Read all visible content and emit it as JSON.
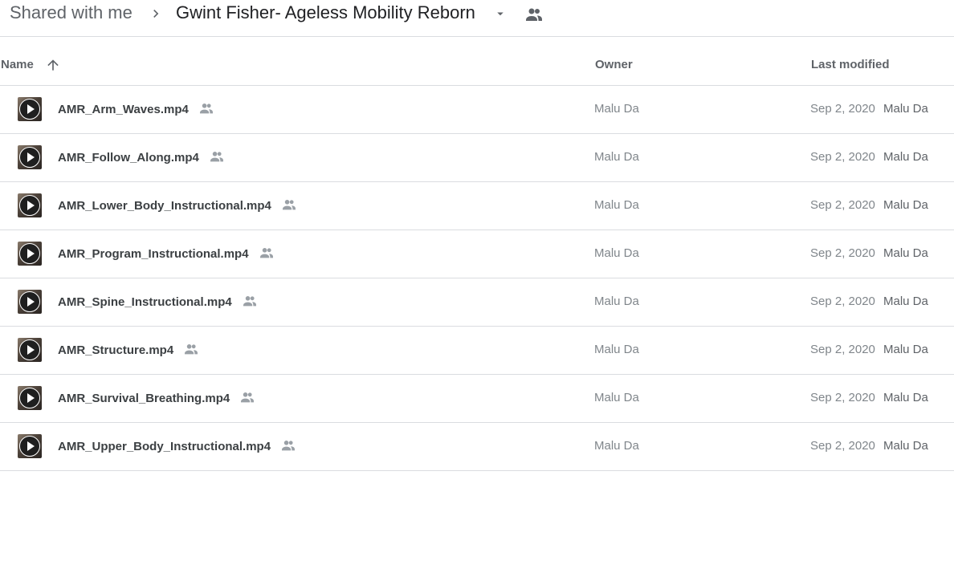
{
  "breadcrumb": {
    "root": "Shared with me",
    "separator_icon": "chevron-right-icon",
    "current_folder": "Gwint Fisher- Ageless Mobility Reborn",
    "dropdown_icon": "caret-down-icon",
    "shared_icon": "people-icon"
  },
  "columns": {
    "name": "Name",
    "owner": "Owner",
    "last_modified": "Last modified",
    "sort_icon": "arrow-up-icon"
  },
  "files": [
    {
      "name": "AMR_Arm_Waves.mp4",
      "owner": "Malu Da",
      "modified_date": "Sep 2, 2020",
      "modified_by": "Malu Da"
    },
    {
      "name": "AMR_Follow_Along.mp4",
      "owner": "Malu Da",
      "modified_date": "Sep 2, 2020",
      "modified_by": "Malu Da"
    },
    {
      "name": "AMR_Lower_Body_Instructional.mp4",
      "owner": "Malu Da",
      "modified_date": "Sep 2, 2020",
      "modified_by": "Malu Da"
    },
    {
      "name": "AMR_Program_Instructional.mp4",
      "owner": "Malu Da",
      "modified_date": "Sep 2, 2020",
      "modified_by": "Malu Da"
    },
    {
      "name": "AMR_Spine_Instructional.mp4",
      "owner": "Malu Da",
      "modified_date": "Sep 2, 2020",
      "modified_by": "Malu Da"
    },
    {
      "name": "AMR_Structure.mp4",
      "owner": "Malu Da",
      "modified_date": "Sep 2, 2020",
      "modified_by": "Malu Da"
    },
    {
      "name": "AMR_Survival_Breathing.mp4",
      "owner": "Malu Da",
      "modified_date": "Sep 2, 2020",
      "modified_by": "Malu Da"
    },
    {
      "name": "AMR_Upper_Body_Instructional.mp4",
      "owner": "Malu Da",
      "modified_date": "Sep 2, 2020",
      "modified_by": "Malu Da"
    }
  ],
  "colors": {
    "text_primary": "#202124",
    "text_secondary": "#5f6368",
    "divider": "#dadce0"
  }
}
